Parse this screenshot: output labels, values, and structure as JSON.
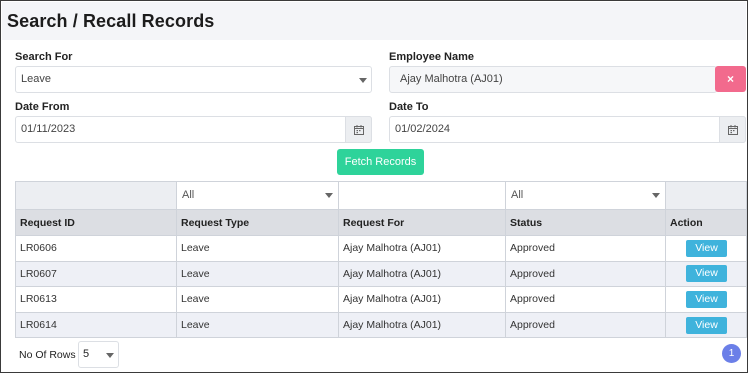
{
  "page": {
    "title": "Search / Recall Records"
  },
  "form": {
    "search_for": {
      "label": "Search For",
      "value": "Leave"
    },
    "employee_name": {
      "label": "Employee Name",
      "value": "Ajay Malhotra (AJ01)",
      "clear_icon": "close-icon",
      "clear_label": "×"
    },
    "date_from": {
      "label": "Date From",
      "value": "01/11/2023",
      "icon": "calendar-icon"
    },
    "date_to": {
      "label": "Date To",
      "value": "01/02/2024",
      "icon": "calendar-icon"
    },
    "fetch_label": "Fetch Records"
  },
  "table": {
    "filters": {
      "request_type": "All",
      "request_for": "",
      "status": "All"
    },
    "columns": [
      "Request ID",
      "Request Type",
      "Request For",
      "Status",
      "Action"
    ],
    "rows": [
      {
        "id": "LR0606",
        "type": "Leave",
        "for": "Ajay Malhotra (AJ01)",
        "status": "Approved",
        "action": "View"
      },
      {
        "id": "LR0607",
        "type": "Leave",
        "for": "Ajay Malhotra (AJ01)",
        "status": "Approved",
        "action": "View"
      },
      {
        "id": "LR0613",
        "type": "Leave",
        "for": "Ajay Malhotra (AJ01)",
        "status": "Approved",
        "action": "View"
      },
      {
        "id": "LR0614",
        "type": "Leave",
        "for": "Ajay Malhotra (AJ01)",
        "status": "Approved",
        "action": "View"
      }
    ]
  },
  "footer": {
    "rows_label": "No Of Rows :",
    "rows_value": "5",
    "page": "1"
  },
  "colors": {
    "clear": "#f26a8d",
    "fetch": "#2ed39a",
    "view": "#3fb3dc",
    "page": "#6b7fe8"
  }
}
